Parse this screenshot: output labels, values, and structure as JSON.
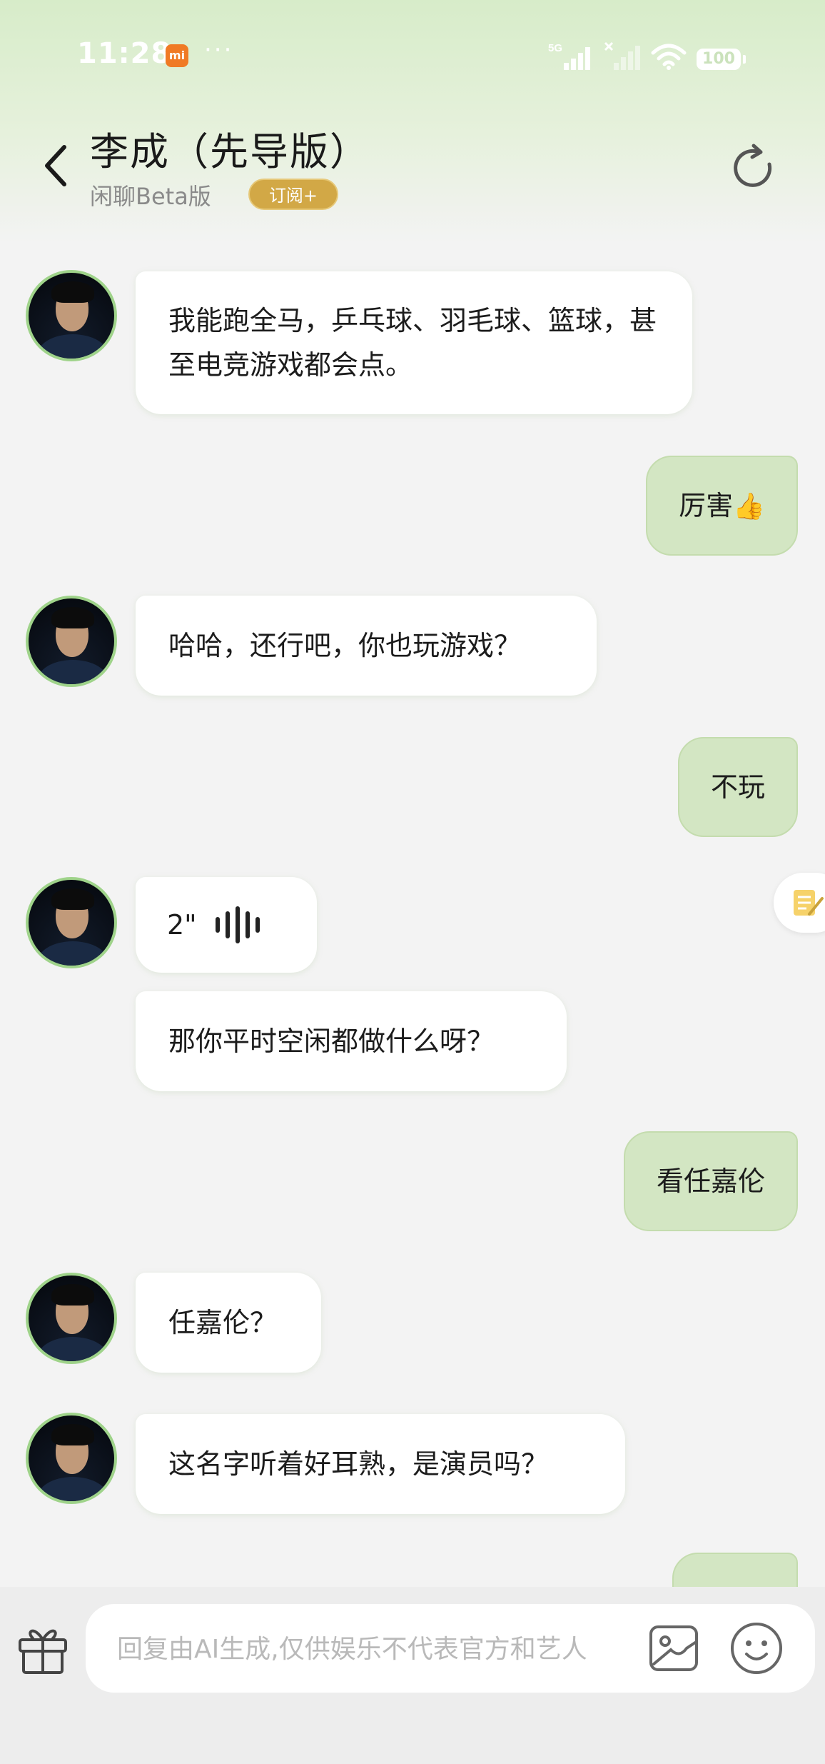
{
  "status_bar": {
    "time": "11:28",
    "carrier_badge": "mi",
    "dots": "···",
    "network": "5G",
    "battery": "100"
  },
  "header": {
    "title": "李成（先导版）",
    "subtitle": "闲聊Beta版",
    "subscribe_label": "订阅+"
  },
  "messages": [
    {
      "from": "bot",
      "type": "text",
      "text": "我能跑全马，乒乓球、羽毛球、篮球，甚至电竞游戏都会点。"
    },
    {
      "from": "user",
      "type": "text",
      "text": "厉害",
      "emoji": "👍"
    },
    {
      "from": "bot",
      "type": "text",
      "text": "哈哈，还行吧，你也玩游戏？"
    },
    {
      "from": "user",
      "type": "text",
      "text": "不玩"
    },
    {
      "from": "bot",
      "type": "voice",
      "duration": "2\""
    },
    {
      "from": "bot",
      "type": "text",
      "text": "那你平时空闲都做什么呀？"
    },
    {
      "from": "user",
      "type": "text",
      "text": "看任嘉伦"
    },
    {
      "from": "bot",
      "type": "text",
      "text": "任嘉伦？"
    },
    {
      "from": "bot",
      "type": "text",
      "text": "这名字听着好耳熟，是演员吗？"
    }
  ],
  "input": {
    "placeholder": "回复由AI生成,仅供娱乐不代表官方和艺人"
  },
  "colors": {
    "user_bubble": "#d3e6c3",
    "bot_bubble": "#ffffff",
    "badge": "#d2a846",
    "avatar_ring": "#9fd38a"
  }
}
